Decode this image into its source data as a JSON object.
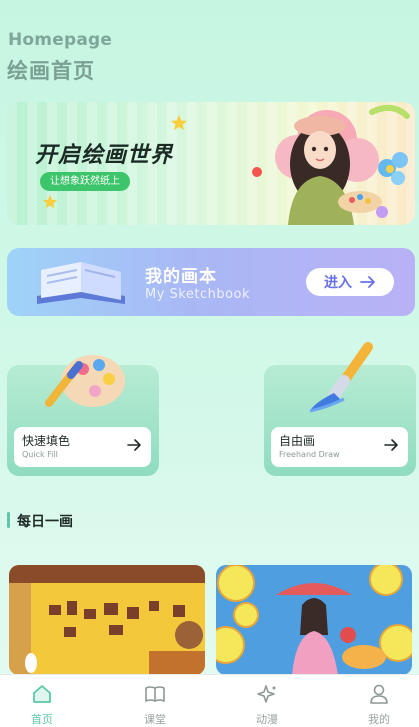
{
  "header": {
    "title_en": "Homepage",
    "title_cn": "绘画首页"
  },
  "hero": {
    "title": "开启绘画世界",
    "subtitle": "让想象跃然纸上",
    "illustration": "girl-with-palette-illustration"
  },
  "sketchbook": {
    "title_cn": "我的画本",
    "title_en": "My Sketchbook",
    "button_label": "进入",
    "button_icon": "arrow-right-icon",
    "illustration": "open-book-illustration"
  },
  "cards": [
    {
      "title": "快速填色",
      "subtitle": "Quick Fill",
      "icon": "paint-palette-icon",
      "arrow": "arrow-right-icon"
    },
    {
      "title": "自由画",
      "subtitle": "Freehand Draw",
      "icon": "paint-brush-icon",
      "arrow": "arrow-right-icon"
    }
  ],
  "daily": {
    "title": "每日一画",
    "items": [
      {
        "name": "room-artwork-thumbnail"
      },
      {
        "name": "lemon-girl-artwork-thumbnail"
      }
    ]
  },
  "tabbar": {
    "items": [
      {
        "label": "首页",
        "icon": "home-icon",
        "active": true
      },
      {
        "label": "课堂",
        "icon": "book-icon",
        "active": false
      },
      {
        "label": "动漫",
        "icon": "sparkle-icon",
        "active": false
      },
      {
        "label": "我的",
        "icon": "user-icon",
        "active": false
      }
    ]
  },
  "colors": {
    "accent": "#5cc7a8",
    "background": "#c6f6e2",
    "hero_pill": "#3cc56a",
    "sketch_button_text": "#6872e6"
  }
}
